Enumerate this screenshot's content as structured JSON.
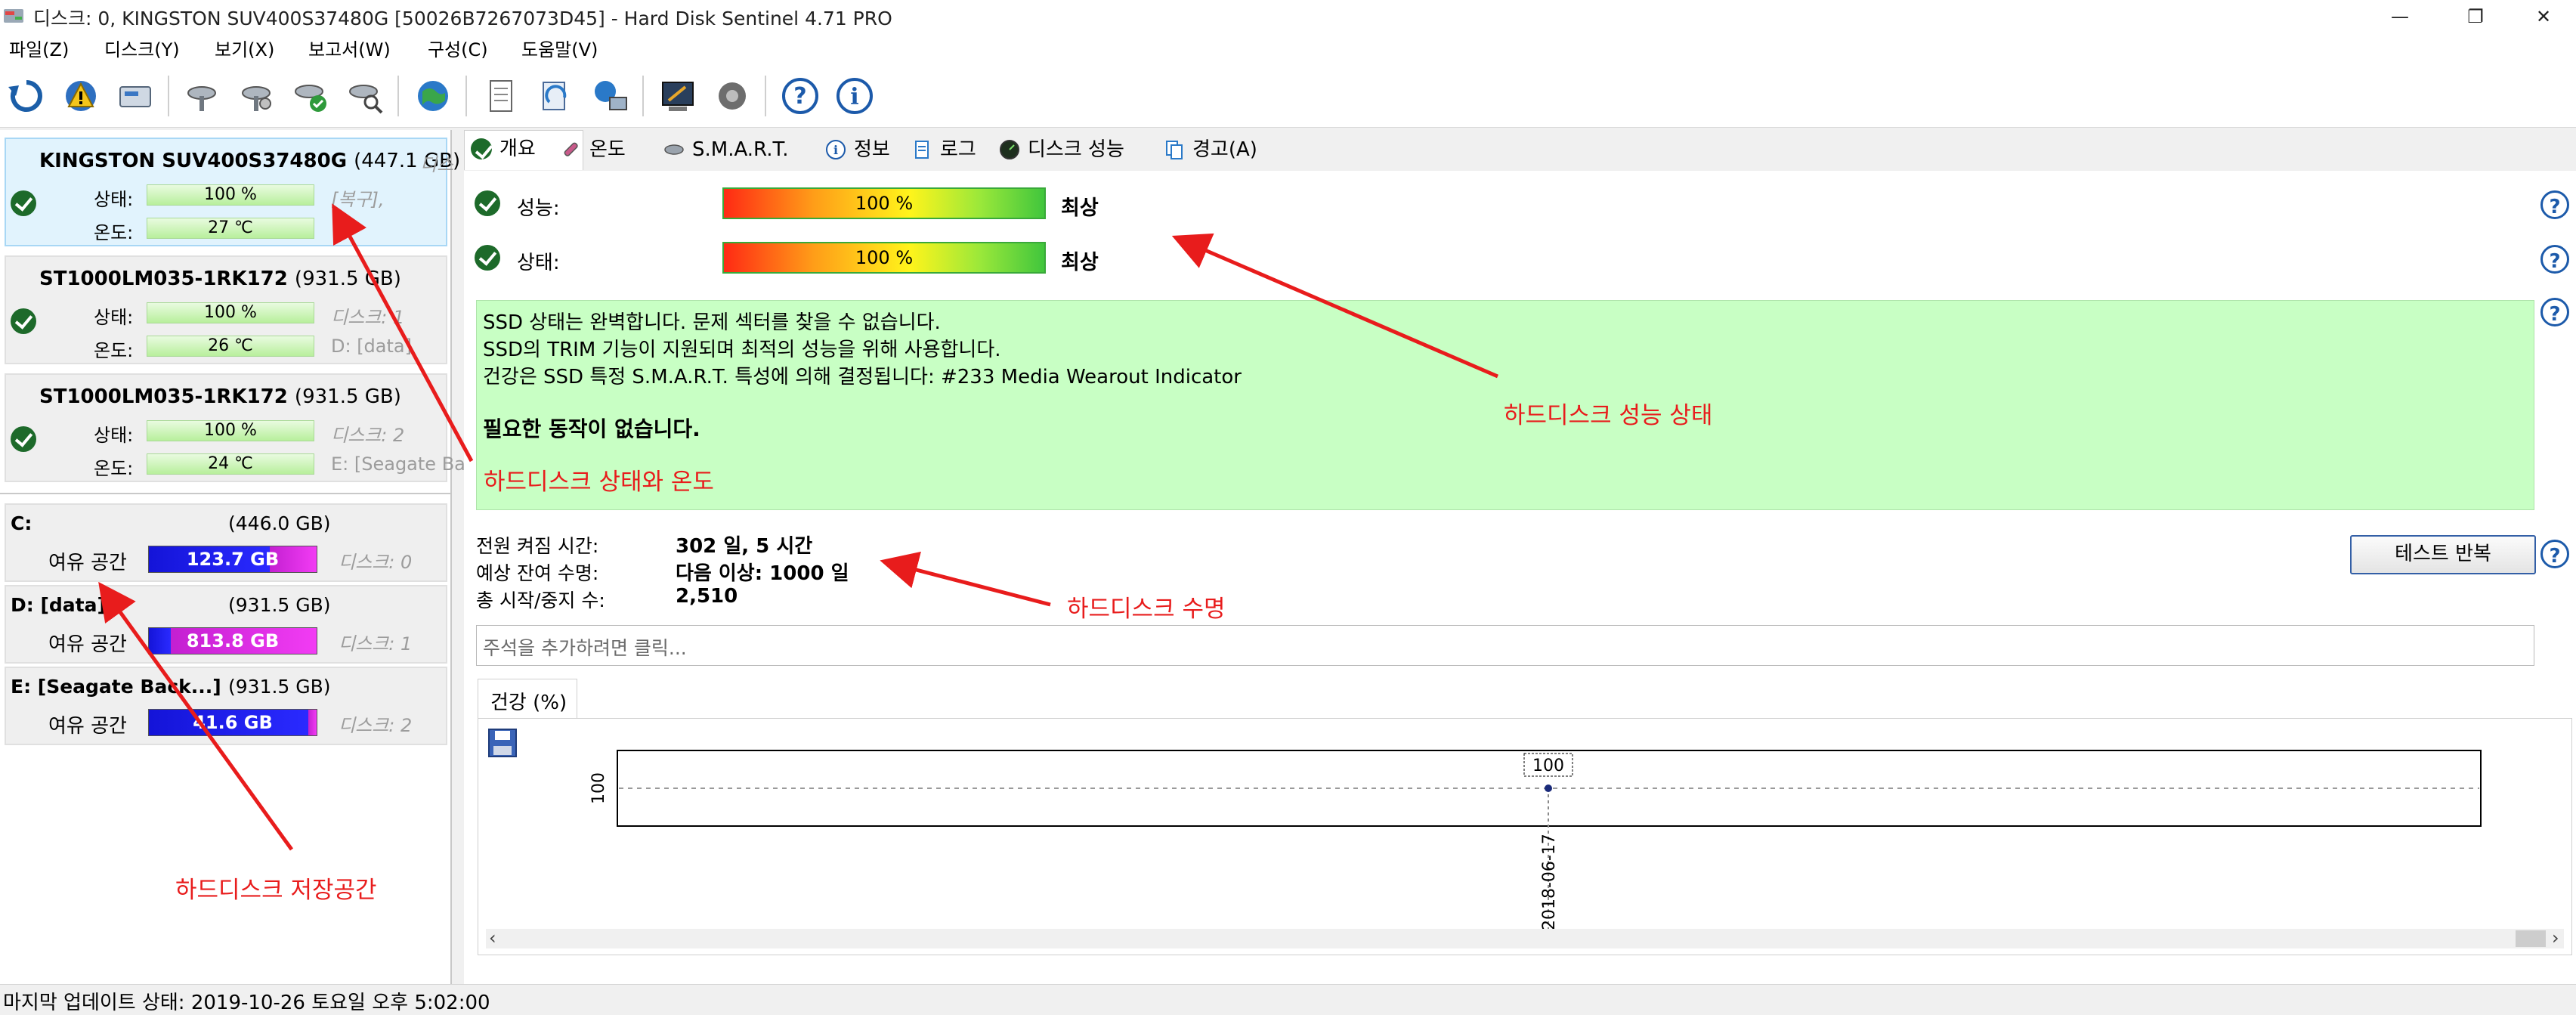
{
  "window": {
    "title": "디스크: 0, KINGSTON SUV400S37480G [50026B7267073D45]  -  Hard Disk Sentinel 4.71 PRO",
    "minimize": "—",
    "restore": "❐",
    "close": "✕"
  },
  "menu": [
    "파일(Z)",
    "디스크(Y)",
    "보기(X)",
    "보고서(W)",
    "구성(C)",
    "도움말(V)"
  ],
  "toolbar_icons": [
    "refresh-icon",
    "alert-update-icon",
    "disk-info-icon",
    "disk-tool-1-icon",
    "disk-tool-2-icon",
    "disk-check-icon",
    "disk-search-icon",
    "web-icon",
    "report-icon",
    "send-report-icon",
    "network-icon",
    "settings-icon",
    "sound-icon",
    "help-icon",
    "info-icon"
  ],
  "disks": [
    {
      "name": "KINGSTON SUV400S37480G",
      "size": "(447.1 GB)",
      "status_label": "상태:",
      "status": "100 %",
      "temp_label": "온도:",
      "temp": "27 ℃",
      "note1": "디스",
      "note2": "[복구],",
      "selected": true
    },
    {
      "name": "ST1000LM035-1RK172",
      "size": "(931.5 GB)",
      "status_label": "상태:",
      "status": "100 %",
      "temp_label": "온도:",
      "temp": "26 ℃",
      "note1": "디스크: 1",
      "note2": "D: [data]"
    },
    {
      "name": "ST1000LM035-1RK172",
      "size": "(931.5 GB)",
      "status_label": "상태:",
      "status": "100 %",
      "temp_label": "온도:",
      "temp": "24 ℃",
      "note1": "디스크: 2",
      "note2": "E: [Seagate Ba"
    }
  ],
  "volumes": [
    {
      "name": "C:",
      "size": "(446.0 GB)",
      "free_label": "여유 공간",
      "free": "123.7 GB",
      "free_fraction": 0.28,
      "note": "디스크: 0"
    },
    {
      "name": "D: [data]",
      "size": "(931.5 GB)",
      "free_label": "여유 공간",
      "free": "813.8 GB",
      "free_fraction": 0.87,
      "note": "디스크: 1"
    },
    {
      "name": "E: [Seagate Back...]",
      "size": "(931.5 GB)",
      "free_label": "여유 공간",
      "free": "41.6 GB",
      "free_fraction": 0.05,
      "note": "디스크: 2"
    }
  ],
  "tabs": [
    {
      "label": "개요",
      "icon": "check-icon",
      "active": true
    },
    {
      "label": "온도",
      "icon": "thermometer-icon"
    },
    {
      "label": "S.M.A.R.T.",
      "icon": "smart-icon"
    },
    {
      "label": "정보",
      "icon": "info-icon"
    },
    {
      "label": "로그",
      "icon": "log-icon"
    },
    {
      "label": "디스크 성능",
      "icon": "gauge-icon"
    },
    {
      "label": "경고(A)",
      "icon": "warning-copy-icon"
    }
  ],
  "overview": {
    "performance_label": "성능:",
    "performance_value": "100 %",
    "performance_rating": "최상",
    "health_label": "상태:",
    "health_value": "100 %",
    "health_rating": "최상",
    "status_lines": [
      "SSD 상태는 완벽합니다. 문제 섹터를 찾을 수 없습니다.",
      "SSD의 TRIM 기능이 지원되며 최적의 성능을 위해 사용합니다.",
      "건강은 SSD 특정 S.M.A.R.T. 특성에 의해 결정됩니다:  #233 Media Wearout Indicator"
    ],
    "action_text": "필요한 동작이 없습니다.",
    "power_on_label": "전원 켜짐 시간:",
    "power_on_value": "302 일, 5 시간",
    "lifetime_label": "예상 잔여 수명:",
    "lifetime_value": "다음 이상: 1000 일",
    "start_stop_label": "총 시작/중지 수:",
    "start_stop_value": "2,510",
    "repeat_test_button": "테스트 반복",
    "comment_placeholder": "주석을 추가하려면 클릭...",
    "help_glyph": "?"
  },
  "chart_data": {
    "type": "line",
    "tab_label": "건강 (%)",
    "x": [
      "2018-06-17"
    ],
    "series": [
      {
        "values": [
          100
        ]
      }
    ],
    "ytick": "100",
    "data_label": "100"
  },
  "annotations": {
    "status_temp": "하드디스크 상태와 온도",
    "performance": "하드디스크 성능 상태",
    "lifetime": "하드디스크 수명",
    "storage": "하드디스크 저장공간"
  },
  "statusbar": {
    "text": "마지막 업데이트 상태: 2019-10-26 토요일 오후 5:02:00"
  }
}
